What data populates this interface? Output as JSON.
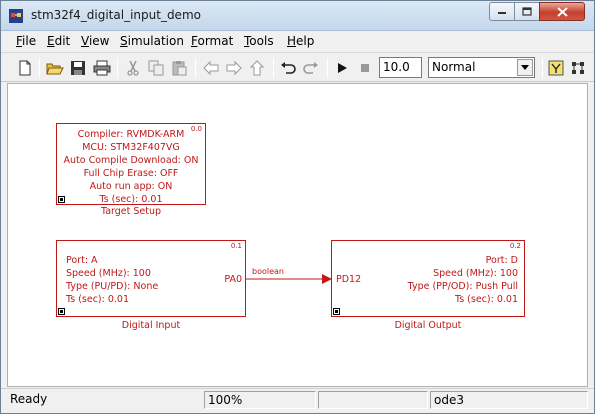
{
  "window": {
    "title": "stm32f4_digital_input_demo"
  },
  "menu": [
    "File",
    "Edit",
    "View",
    "Simulation",
    "Format",
    "Tools",
    "Help"
  ],
  "toolbar": {
    "stop_time": "10.0",
    "sim_mode": "Normal"
  },
  "blocks": {
    "target_setup": {
      "index": "0.0",
      "lines": [
        "Compiler: RVMDK-ARM",
        "MCU: STM32F407VG",
        "Auto Compile Download: ON",
        "Full Chip Erase: OFF",
        "Auto run app: ON",
        "Ts (sec): 0.01"
      ],
      "caption": "Target Setup"
    },
    "digital_input": {
      "index": "0.1",
      "lines": [
        "Port: A",
        "Speed (MHz): 100",
        "Type (PU/PD): None",
        "Ts (sec): 0.01"
      ],
      "port_label": "PA0",
      "caption": "Digital Input"
    },
    "digital_output": {
      "index": "0.2",
      "lines": [
        "Port: D",
        "Speed (MHz): 100",
        "Type (PP/OD): Push Pull",
        "Ts (sec): 0.01"
      ],
      "port_label": "PD12",
      "caption": "Digital Output"
    }
  },
  "connection": {
    "signal_type": "boolean"
  },
  "statusbar": {
    "status": "Ready",
    "zoom": "100%",
    "solver": "ode3"
  },
  "colors": {
    "block": "#c01818"
  }
}
